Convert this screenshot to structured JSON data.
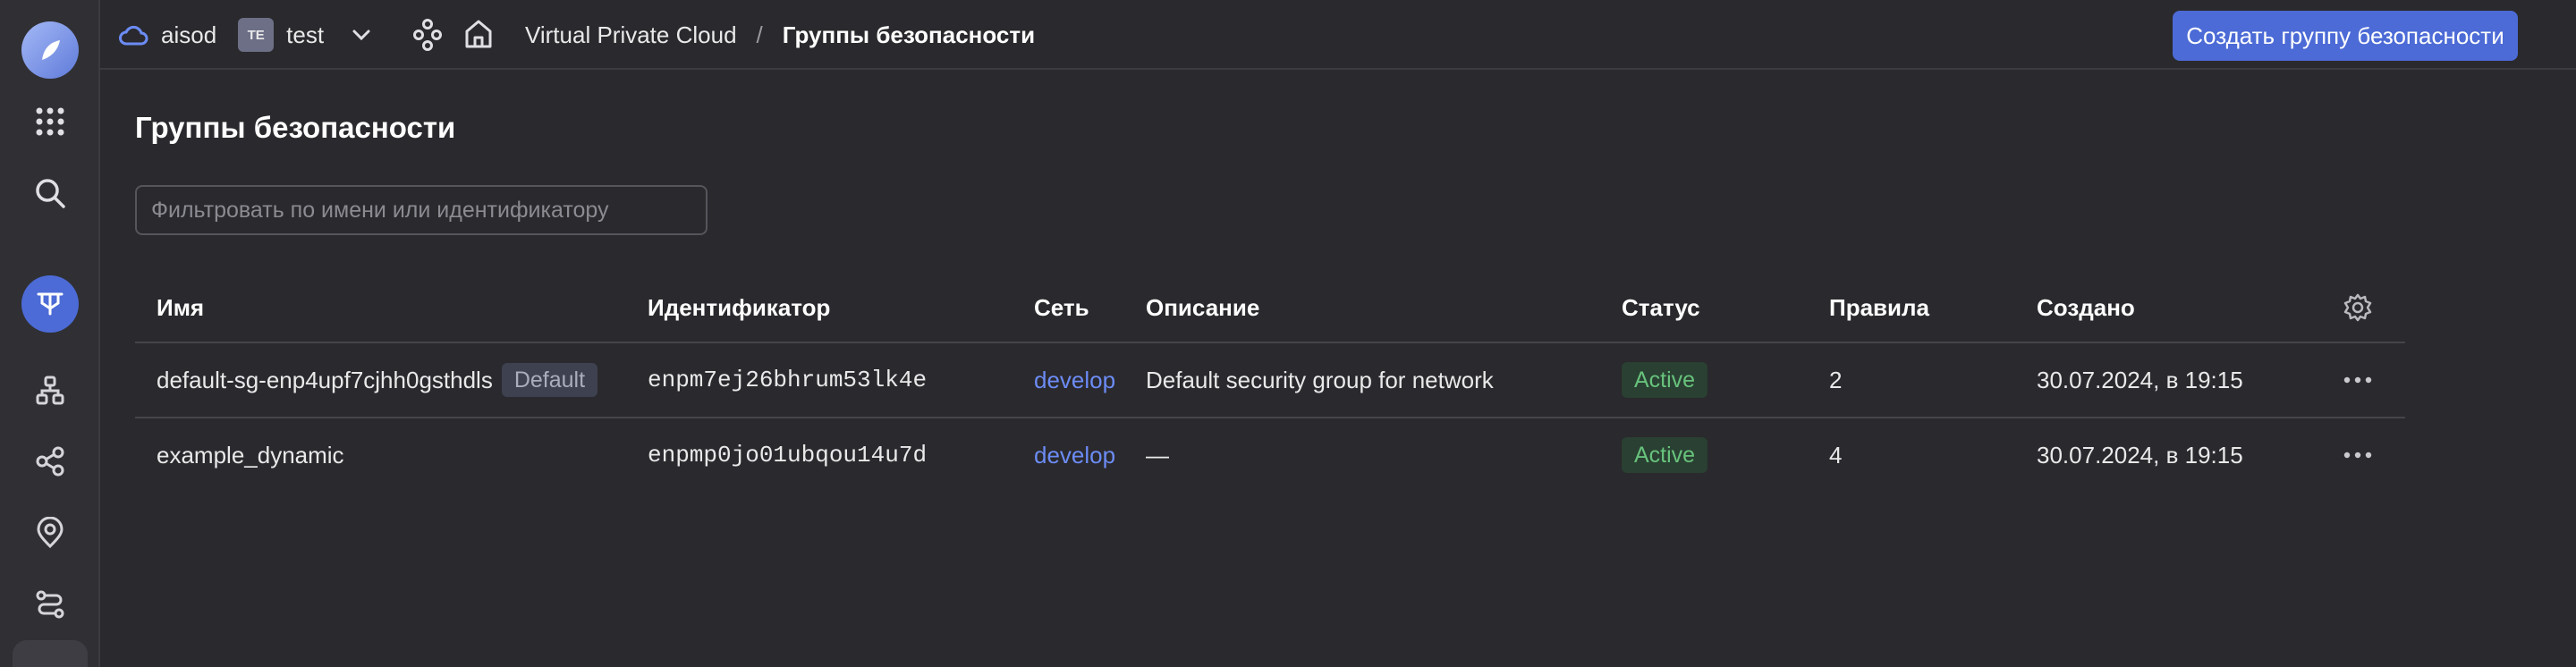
{
  "header": {
    "cloud_name": "aisod",
    "folder_badge": "TE",
    "folder_name": "test",
    "breadcrumb": [
      "Virtual Private Cloud",
      "/",
      "Группы безопасности"
    ],
    "create_button": "Создать группу безопасности"
  },
  "main": {
    "title": "Группы безопасности",
    "filter_placeholder": "Фильтровать по имени или идентификатору",
    "columns": [
      "Имя",
      "Идентификатор",
      "Сеть",
      "Описание",
      "Статус",
      "Правила",
      "Создано"
    ],
    "rows": [
      {
        "name": "default-sg-enp4upf7cjhh0gsthdls",
        "badge": "Default",
        "id": "enpm7ej26bhrum53lk4e",
        "network": "develop",
        "description": "Default security group for network",
        "status": "Active",
        "rules": "2",
        "created": "30.07.2024, в 19:15"
      },
      {
        "name": "example_dynamic",
        "badge": "",
        "id": "enpmp0jo01ubqou14u7d",
        "network": "develop",
        "description": "—",
        "status": "Active",
        "rules": "4",
        "created": "30.07.2024, в 19:15"
      }
    ]
  },
  "sidebar_icons": [
    "logo-icon",
    "apps-grid-icon",
    "search-icon",
    "vpc-service-icon",
    "network-topology-icon",
    "share-nodes-icon",
    "location-pin-icon",
    "route-icon"
  ],
  "colors": {
    "accent": "#4c6bd6",
    "link": "#6c8cf5",
    "status_active": "#68c27c",
    "background": "#2a292d"
  }
}
